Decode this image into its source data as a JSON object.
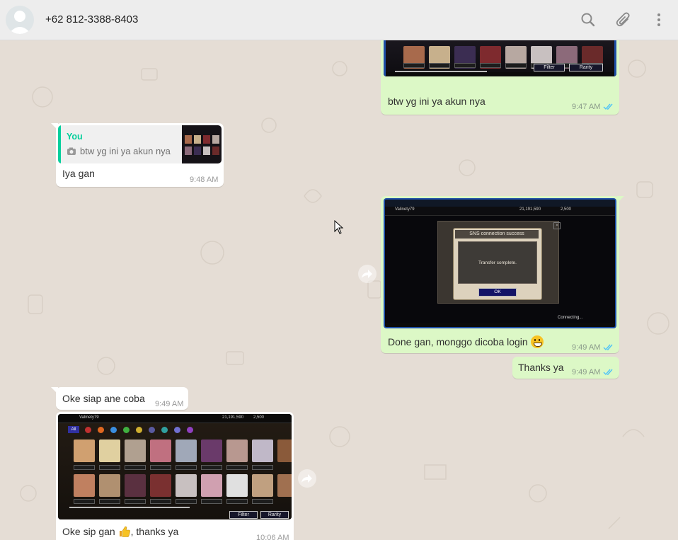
{
  "header": {
    "contact_name": "+62 812-3388-8403",
    "icons": [
      "avatar-icon",
      "search-icon",
      "attach-icon",
      "menu-icon"
    ]
  },
  "messages": [
    {
      "direction": "outgoing",
      "type": "image",
      "caption": "btw yg ini ya akun nya",
      "time": "9:47 AM",
      "status": "read",
      "image": {
        "buttons": [
          "Filter",
          "Rarity"
        ]
      }
    },
    {
      "direction": "incoming",
      "type": "reply",
      "quote_author": "You",
      "quote_text": "btw yg ini ya akun nya",
      "text": "Iya gan",
      "time": "9:48 AM"
    },
    {
      "direction": "outgoing",
      "type": "image",
      "caption": "Done gan, monggo dicoba login",
      "caption_emoji": "grinning-face-emoji",
      "time": "9:49 AM",
      "status": "read",
      "image": {
        "dialog_title": "SNS connection success",
        "dialog_text": "Transfer complete.",
        "dialog_button": "OK",
        "status_text": "Connecting...",
        "username": "Valinety79",
        "gold": "21,191,590",
        "gems": "2,500"
      }
    },
    {
      "direction": "outgoing",
      "type": "text",
      "text": "Thanks ya",
      "time": "9:49 AM",
      "status": "read"
    },
    {
      "direction": "incoming",
      "type": "text",
      "text": "Oke siap ane coba",
      "time": "9:49 AM"
    },
    {
      "direction": "incoming",
      "type": "image",
      "caption": "Oke sip gan",
      "caption_emoji": "thumbs-up-emoji",
      "caption_after": ", thanks ya",
      "time": "10:06 AM",
      "image": {
        "username": "Valinety79",
        "gold": "21,191,590",
        "gems": "2,500",
        "filter_label": "All",
        "buttons": [
          "Filter",
          "Rarity"
        ]
      }
    }
  ],
  "colors": {
    "chat_bg": "#e5ddd5",
    "outgoing": "#dcf8c6",
    "incoming": "#ffffff",
    "read_ticks": "#4fc3f7",
    "quote_accent": "#06cf9c"
  }
}
